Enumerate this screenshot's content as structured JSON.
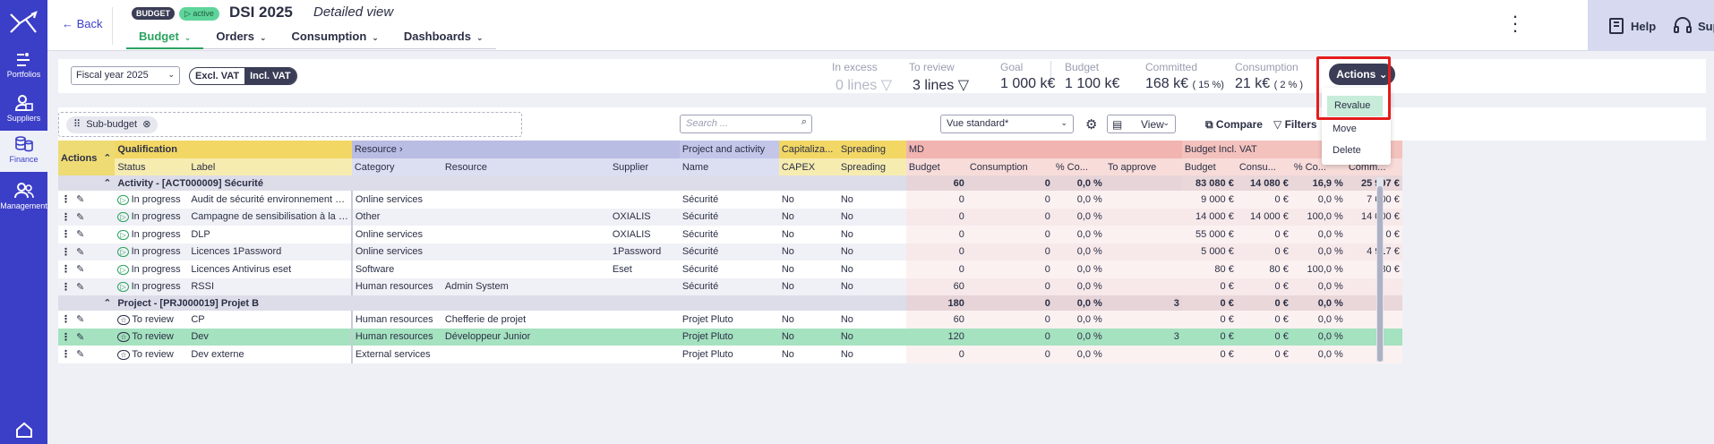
{
  "sidebar": {
    "items": [
      {
        "label": "Portfolios",
        "icon": "portfolio-icon"
      },
      {
        "label": "Suppliers",
        "icon": "suppliers-icon"
      },
      {
        "label": "Finance",
        "icon": "finance-icon",
        "active": true
      },
      {
        "label": "Management",
        "icon": "management-icon"
      }
    ]
  },
  "header": {
    "back_label": "Back",
    "badge_budget": "BUDGET",
    "badge_active": "▷ active",
    "title": "DSI 2025",
    "subtitle": "Detailed view",
    "tabs": [
      {
        "label": "Budget",
        "active": true
      },
      {
        "label": "Orders"
      },
      {
        "label": "Consumption"
      },
      {
        "label": "Dashboards"
      }
    ],
    "help_label": "Help",
    "support_label": "Support"
  },
  "toolbar": {
    "fiscal_year": "Fiscal year 2025",
    "vat_excl": "Excl. VAT",
    "vat_incl": "Incl. VAT",
    "stats": {
      "in_excess_label": "In excess",
      "in_excess_value": "0  lines",
      "to_review_label": "To review",
      "to_review_value": "3  lines",
      "goal_label": "Goal",
      "goal_value": "1 000 k€",
      "budget_label": "Budget",
      "budget_value": "1 100 k€",
      "committed_label": "Committed",
      "committed_value": "168 k€",
      "committed_pct": "( 15 %)",
      "consumption_label": "Consumption",
      "consumption_value": "21 k€",
      "consumption_pct": "( 2 % )"
    },
    "actions_label": "Actions",
    "actions_menu": [
      "Revalue",
      "Move",
      "Delete"
    ]
  },
  "filters": {
    "chip_label": "Sub-budget",
    "search_placeholder": "Search ...",
    "view_select": "Vue standard*",
    "view_label": "View",
    "compare_label": "Compare",
    "filters_label": "Filters"
  },
  "table": {
    "group_headers": [
      "Actions",
      "Qualification",
      "Resource",
      "Project and activity",
      "Capitaliza...",
      "Spreading",
      "MD",
      "Budget Incl. VAT"
    ],
    "sub_headers": [
      "Status",
      "Label",
      "Category",
      "Resource",
      "Supplier",
      "Name",
      "CAPEX",
      "Spreading",
      "Budget",
      "Consumption",
      "% Co...",
      "To approve",
      "Budget",
      "Consu...",
      "% Co...",
      "Comm..."
    ],
    "groups": [
      {
        "title": "Activity - [ACT000009] Sécurité",
        "md_budget": "60",
        "md_cons": "0",
        "md_pct": "0,0 %",
        "md_appr": "",
        "b_budget": "83 080 €",
        "b_cons": "14 080 €",
        "b_pct": "16,9 %",
        "b_comm": "25 997 €",
        "rows": [
          {
            "status": "In progress",
            "label": "Audit de sécurité environnement …",
            "category": "Online services",
            "resource": "",
            "supplier": "",
            "name": "Sécurité",
            "capex": "No",
            "spreading": "No",
            "md_budget": "0",
            "md_cons": "0",
            "md_pct": "0,0 %",
            "md_appr": "",
            "b_budget": "9 000 €",
            "b_cons": "0 €",
            "b_pct": "0,0 %",
            "b_comm": "7 000 €"
          },
          {
            "status": "In progress",
            "label": "Campagne de sensibilisation à la …",
            "category": "Other",
            "resource": "",
            "supplier": "OXIALIS",
            "name": "Sécurité",
            "capex": "No",
            "spreading": "No",
            "md_budget": "0",
            "md_cons": "0",
            "md_pct": "0,0 %",
            "md_appr": "",
            "b_budget": "14 000 €",
            "b_cons": "14 000 €",
            "b_pct": "100,0 %",
            "b_comm": "14 000 €"
          },
          {
            "status": "In progress",
            "label": "DLP",
            "category": "Online services",
            "resource": "",
            "supplier": "OXIALIS",
            "name": "Sécurité",
            "capex": "No",
            "spreading": "No",
            "md_budget": "0",
            "md_cons": "0",
            "md_pct": "0,0 %",
            "md_appr": "",
            "b_budget": "55 000 €",
            "b_cons": "0 €",
            "b_pct": "0,0 %",
            "b_comm": "0 €"
          },
          {
            "status": "In progress",
            "label": "Licences 1Password",
            "category": "Online services",
            "resource": "",
            "supplier": "1Password",
            "name": "Sécurité",
            "capex": "No",
            "spreading": "No",
            "md_budget": "0",
            "md_cons": "0",
            "md_pct": "0,0 %",
            "md_appr": "",
            "b_budget": "5 000 €",
            "b_cons": "0 €",
            "b_pct": "0,0 %",
            "b_comm": "4 917 €"
          },
          {
            "status": "In progress",
            "label": "Licences Antivirus eset",
            "category": "Software",
            "resource": "",
            "supplier": "Eset",
            "name": "Sécurité",
            "capex": "No",
            "spreading": "No",
            "md_budget": "0",
            "md_cons": "0",
            "md_pct": "0,0 %",
            "md_appr": "",
            "b_budget": "80 €",
            "b_cons": "80 €",
            "b_pct": "100,0 %",
            "b_comm": "80 €"
          },
          {
            "status": "In progress",
            "label": "RSSI",
            "category": "Human resources",
            "resource": "Admin System",
            "supplier": "",
            "name": "Sécurité",
            "capex": "No",
            "spreading": "No",
            "md_budget": "60",
            "md_cons": "0",
            "md_pct": "0,0 %",
            "md_appr": "",
            "b_budget": "0 €",
            "b_cons": "0 €",
            "b_pct": "0,0 %",
            "b_comm": ""
          }
        ]
      },
      {
        "title": "Project - [PRJ000019] Projet B",
        "md_budget": "180",
        "md_cons": "0",
        "md_pct": "0,0 %",
        "md_appr": "3",
        "b_budget": "0 €",
        "b_cons": "0 €",
        "b_pct": "0,0 %",
        "b_comm": "",
        "rows": [
          {
            "status": "To review",
            "label": "CP",
            "category": "Human resources",
            "resource": "Chefferie de projet",
            "supplier": "",
            "name": "Projet Pluto",
            "capex": "No",
            "spreading": "No",
            "md_budget": "60",
            "md_cons": "0",
            "md_pct": "0,0 %",
            "md_appr": "",
            "b_budget": "0 €",
            "b_cons": "0 €",
            "b_pct": "0,0 %",
            "b_comm": ""
          },
          {
            "status": "To review",
            "label": "Dev",
            "category": "Human resources",
            "resource": "Développeur Junior",
            "supplier": "",
            "name": "Projet Pluto",
            "capex": "No",
            "spreading": "No",
            "md_budget": "120",
            "md_cons": "0",
            "md_pct": "0,0 %",
            "md_appr": "3",
            "b_budget": "0 €",
            "b_cons": "0 €",
            "b_pct": "0,0 %",
            "b_comm": "",
            "highlight": true
          },
          {
            "status": "To review",
            "label": "Dev externe",
            "category": "External services",
            "resource": "",
            "supplier": "",
            "name": "Projet Pluto",
            "capex": "No",
            "spreading": "No",
            "md_budget": "0",
            "md_cons": "0",
            "md_pct": "0,0 %",
            "md_appr": "",
            "b_budget": "0 €",
            "b_cons": "0 €",
            "b_pct": "0,0 %",
            "b_comm": ""
          }
        ]
      }
    ]
  }
}
